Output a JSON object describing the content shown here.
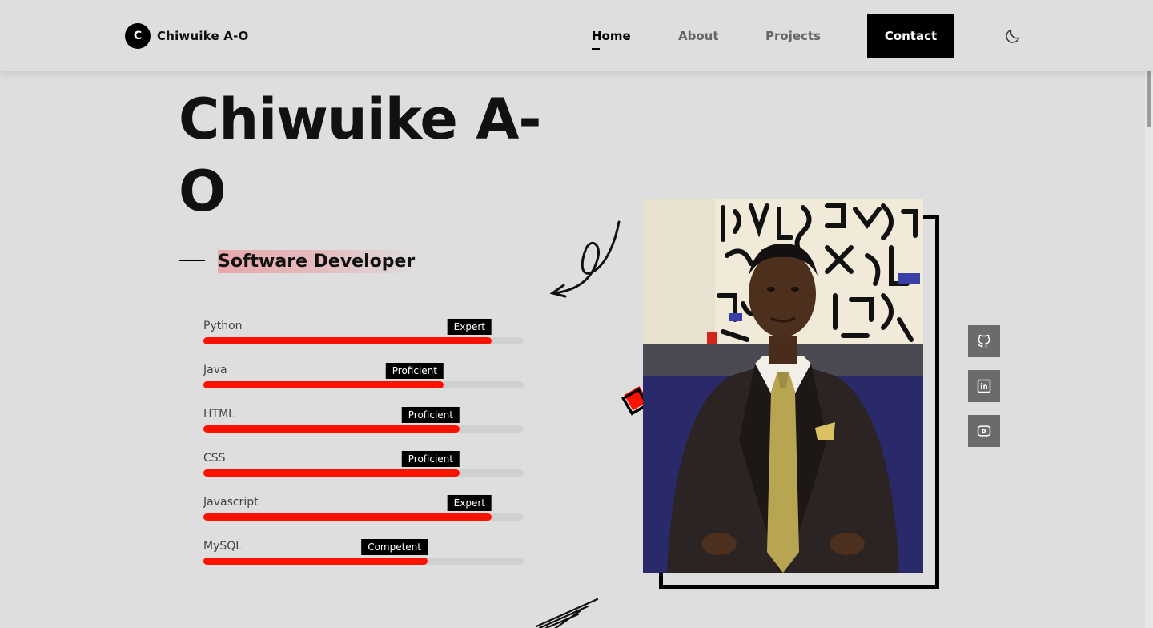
{
  "header": {
    "logo_letter": "C",
    "logo_text": "Chiwuike A-O",
    "nav": {
      "home": "Home",
      "about": "About",
      "projects": "Projects"
    },
    "contact": "Contact",
    "theme_icon": "moon-icon"
  },
  "hero": {
    "name": "Chiwuike A-O",
    "role": "Software Developer"
  },
  "skills": [
    {
      "name": "Python",
      "level": "Expert",
      "percent": 90
    },
    {
      "name": "Java",
      "level": "Proficient",
      "percent": 75
    },
    {
      "name": "HTML",
      "level": "Proficient",
      "percent": 80
    },
    {
      "name": "CSS",
      "level": "Proficient",
      "percent": 80
    },
    {
      "name": "Javascript",
      "level": "Expert",
      "percent": 90
    },
    {
      "name": "MySQL",
      "level": "Competent",
      "percent": 70
    }
  ],
  "socials": [
    {
      "icon": "github-icon"
    },
    {
      "icon": "linkedin-icon"
    },
    {
      "icon": "youtube-icon"
    }
  ],
  "colors": {
    "accent": "#ff1100",
    "background": "#dedede",
    "dark": "#000000"
  }
}
